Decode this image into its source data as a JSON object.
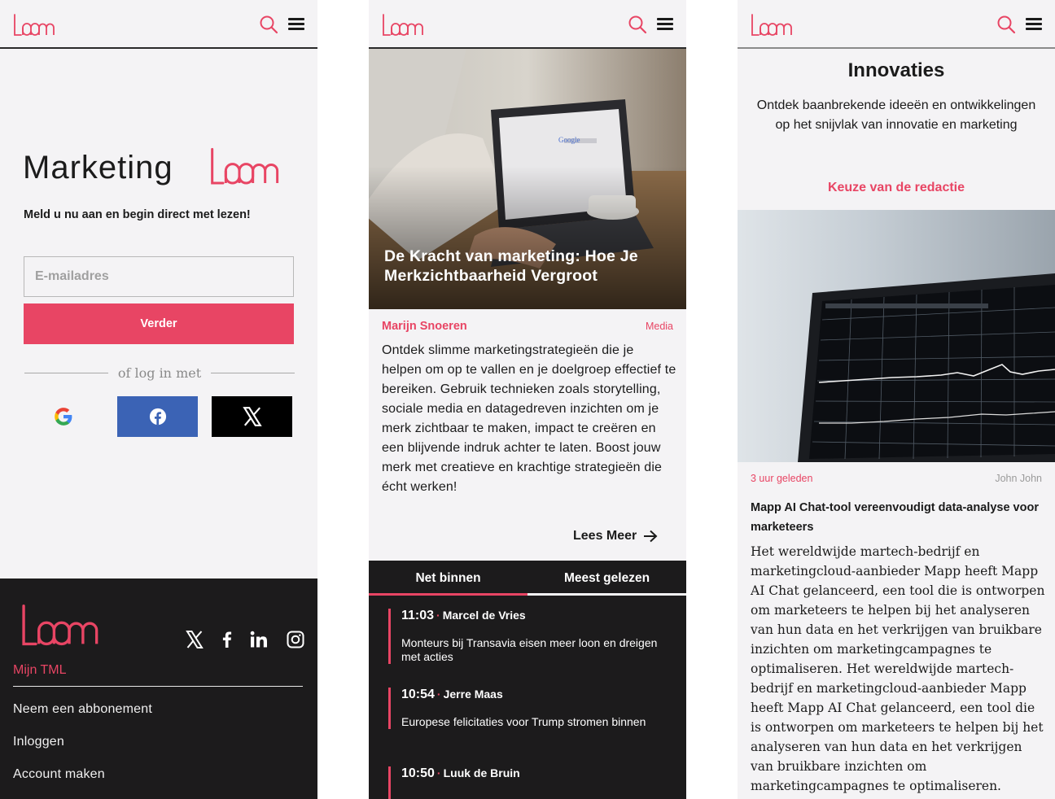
{
  "colors": {
    "accent": "#e84564",
    "dark": "#1c1b1c",
    "background": "#f4f3f5",
    "facebook": "#3b63b5"
  },
  "logo": {
    "text": "loom"
  },
  "login": {
    "brand_word": "Marketing",
    "brand_logo": "loom",
    "signup_text": "Meld u nu aan en begin direct met lezen!",
    "email_placeholder": "E-mailadres",
    "submit_label": "Verder",
    "divider_text": "of log in met",
    "social_buttons": [
      "google-icon",
      "facebook-icon",
      "x-icon"
    ]
  },
  "footer": {
    "social_icons": [
      "x-icon",
      "facebook-icon",
      "linkedin-icon",
      "instagram-icon"
    ],
    "account_label": "Mijn TML",
    "links": [
      "Neem een abbonement",
      "Inloggen",
      "Account maken"
    ]
  },
  "article": {
    "title": "De Kracht van marketing: Hoe Je Merkzichtbaarheid Vergroot",
    "author": "Marijn Snoeren",
    "category": "Media",
    "body": "Ontdek slimme marketingstrategieën die je helpen om op te vallen en je doelgroep effectief te bereiken. Gebruik technieken zoals storytelling, sociale media en datagedreven inzichten om je merk zichtbaar te maken, impact te creëren en een blijvende indruk achter te laten. Boost jouw merk met creatieve en krachtige strategieën die écht werken!",
    "read_more": "Lees Meer"
  },
  "feed": {
    "tabs": [
      "Net binnen",
      "Meest gelezen"
    ],
    "items": [
      {
        "time": "11:03",
        "author": "Marcel de Vries",
        "headline": "Monteurs bij Transavia eisen meer loon en dreigen met acties"
      },
      {
        "time": "10:54",
        "author": "Jerre Maas",
        "headline": "Europese felicitaties voor Trump stromen binnen"
      },
      {
        "time": "10:50",
        "author": "Luuk de Bruin",
        "headline": ""
      }
    ]
  },
  "innovaties": {
    "title": "Innovaties",
    "subtitle": "Ontdek baanbrekende ideeën en ontwikkelingen op het snijvlak van innovatie en marketing",
    "editors_pick": "Keuze van de redactie",
    "time_ago": "3 uur geleden",
    "author": "John John",
    "headline": "Mapp AI Chat-tool vereenvoudigt data-analyse voor marketeers",
    "body": "Het wereldwijde martech-bedrijf en marketingcloud-aanbieder Mapp heeft Mapp AI Chat gelanceerd, een tool die is ontworpen om marketeers te helpen bij het analyseren van hun data en het verkrijgen van bruikbare inzichten om marketingcampagnes te optimaliseren. Het wereldwijde martech-bedrijf en marketingcloud-aanbieder Mapp heeft Mapp AI Chat gelanceerd, een tool die is ontworpen om marketeers te helpen bij het analyseren van hun data en het verkrijgen van bruikbare inzichten om marketingcampagnes te optimaliseren."
  }
}
